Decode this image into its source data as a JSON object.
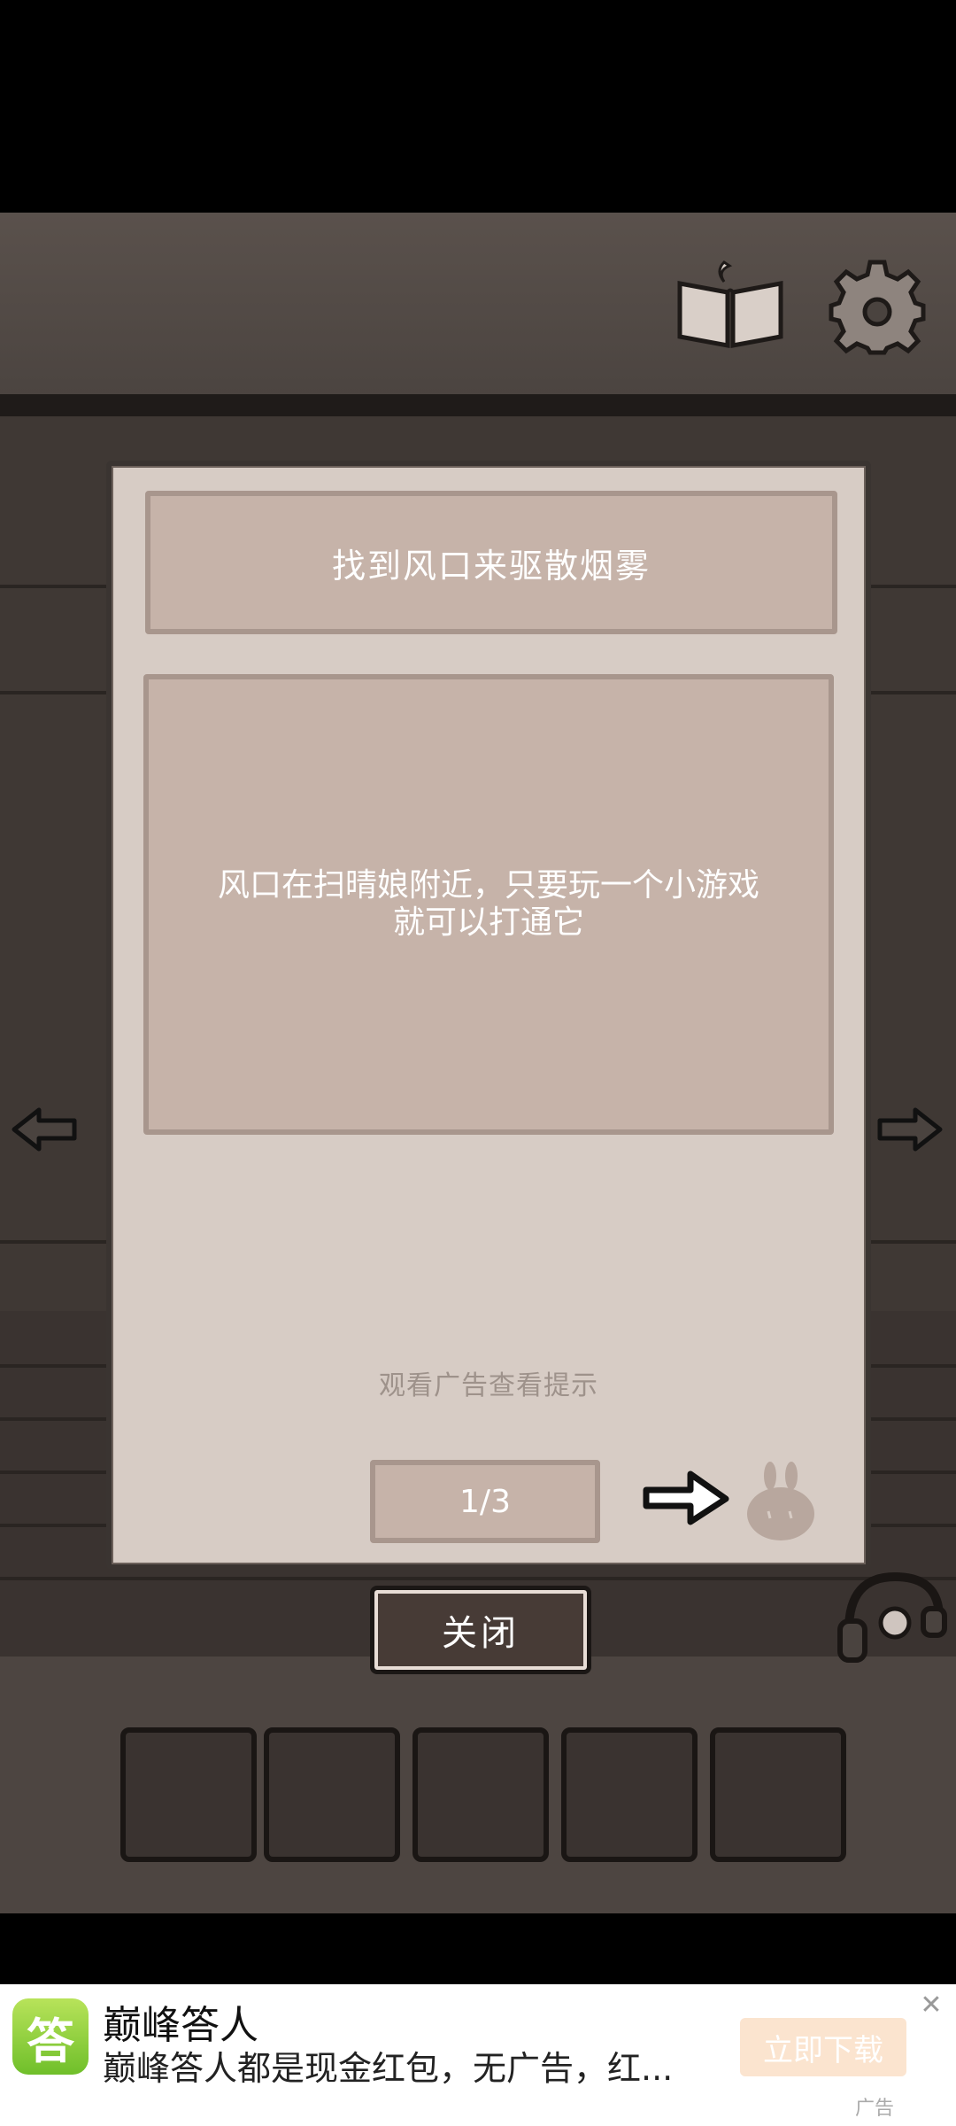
{
  "dialog": {
    "title": "找到风口来驱散烟雾",
    "body_line1": "风口在扫晴娘附近，只要玩一个小游戏",
    "body_line2": "就可以打通它",
    "hint": "观看广告查看提示",
    "page_indicator": "1/3"
  },
  "close_button": "关闭",
  "ad": {
    "app_icon_char": "答",
    "title": "巅峰答人",
    "description": "巅峰答人都是现金红包，无广告，红...",
    "cta": "立即下载",
    "close_symbol": "✕",
    "tag": "广告"
  },
  "icons": [
    "book-icon",
    "gear-icon",
    "arrow-left-icon",
    "arrow-right-icon",
    "next-arrow-icon",
    "bunny-icon",
    "headset-icon"
  ]
}
